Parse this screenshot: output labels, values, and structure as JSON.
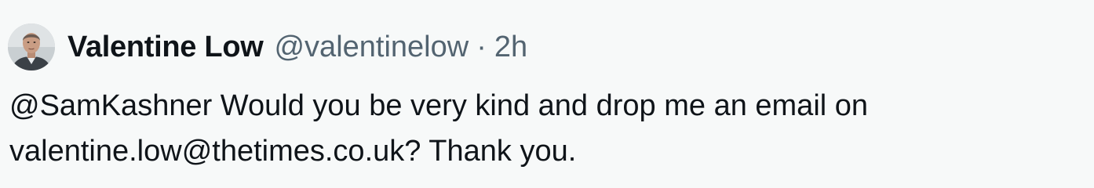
{
  "tweet": {
    "author_name": "Valentine Low",
    "author_handle": "@valentinelow",
    "separator": "·",
    "timestamp": "2h",
    "avatar_icon": "person-avatar",
    "text_line1_mention": "@SamKashner",
    "text_line1_rest": " Would you be very kind and drop me an email on",
    "text_line2_email": "valentine.low@thetimes.co.uk",
    "text_line2_rest": "? Thank you."
  },
  "colors": {
    "background": "#f7f9f9",
    "text_primary": "#0f1419",
    "text_secondary": "#536471"
  }
}
